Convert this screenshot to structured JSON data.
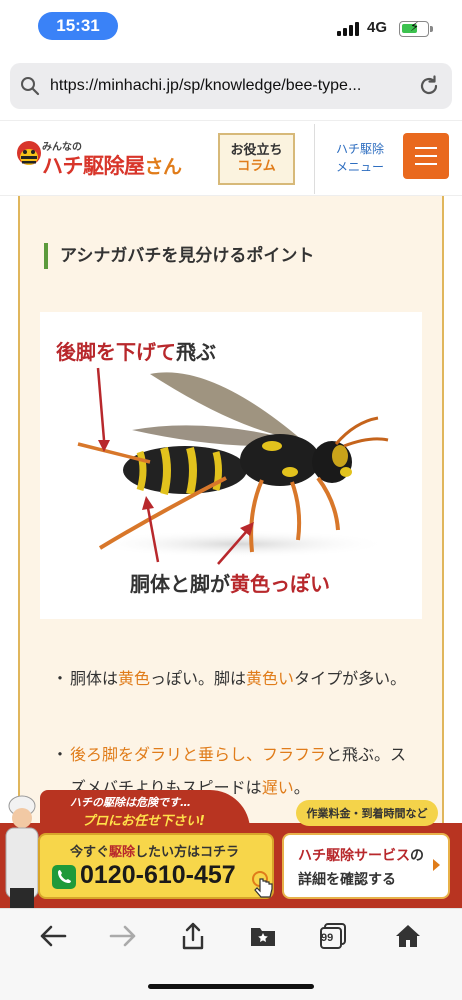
{
  "status_bar": {
    "time": "15:31",
    "network": "4G"
  },
  "browser": {
    "url": "https://minhachi.jp/sp/knowledge/bee-type..."
  },
  "site_header": {
    "logo_small": "みんなの",
    "logo_main": "ハチ駆除屋",
    "logo_suffix": "さん",
    "column_line1": "お役立ち",
    "column_line2": "コラム",
    "menu_line1": "ハチ駆除",
    "menu_line2": "メニュー"
  },
  "article": {
    "heading": "アシナガバチを見分けるポイント",
    "figure": {
      "caption_top": {
        "red": "後脚を下げて",
        "black": "飛ぶ"
      },
      "caption_bottom": {
        "black1": "胴体と脚が",
        "red": "黄色っぽい"
      }
    },
    "bullets": [
      {
        "dot": "・",
        "parts": [
          "胴体は",
          "黄色",
          "っぽい。脚は",
          "黄色い",
          "タイプが多い。"
        ]
      },
      {
        "dot": "・",
        "parts": [
          "後ろ脚をダラリと垂らし、フラフラ",
          "と飛ぶ。スズメバチよりもスピードは",
          "遅い",
          "。"
        ]
      }
    ]
  },
  "promo": {
    "tab_line1": "ハチの駆除は危険です…",
    "tab_line2": "プロにお任せ下さい!",
    "fee_pill": "作業料金・到着時間など",
    "call_line_pre": "今すぐ",
    "call_line_hl": "駆除",
    "call_line_post": "したい方はコチラ",
    "phone_number": "0120-610-457",
    "service_hl": "ハチ駆除サービス",
    "service_post": "の",
    "service_line2": "詳細を確認する"
  },
  "toolbar": {
    "tabs_count": "99"
  },
  "colors": {
    "accent_orange": "#e07c1a",
    "brand_red": "#b8282c",
    "heading_bar_green": "#5c9a3c",
    "content_bg": "#fdf4e6",
    "promo_red": "#b83421",
    "call_yellow": "#f7d64a"
  },
  "icons": [
    "search-icon",
    "reload-icon",
    "bee-mascot-icon",
    "hamburger-icon",
    "phone-icon",
    "tap-hand-icon",
    "back-icon",
    "forward-icon",
    "share-icon",
    "bookmarks-icon",
    "tabs-icon",
    "home-icon"
  ]
}
